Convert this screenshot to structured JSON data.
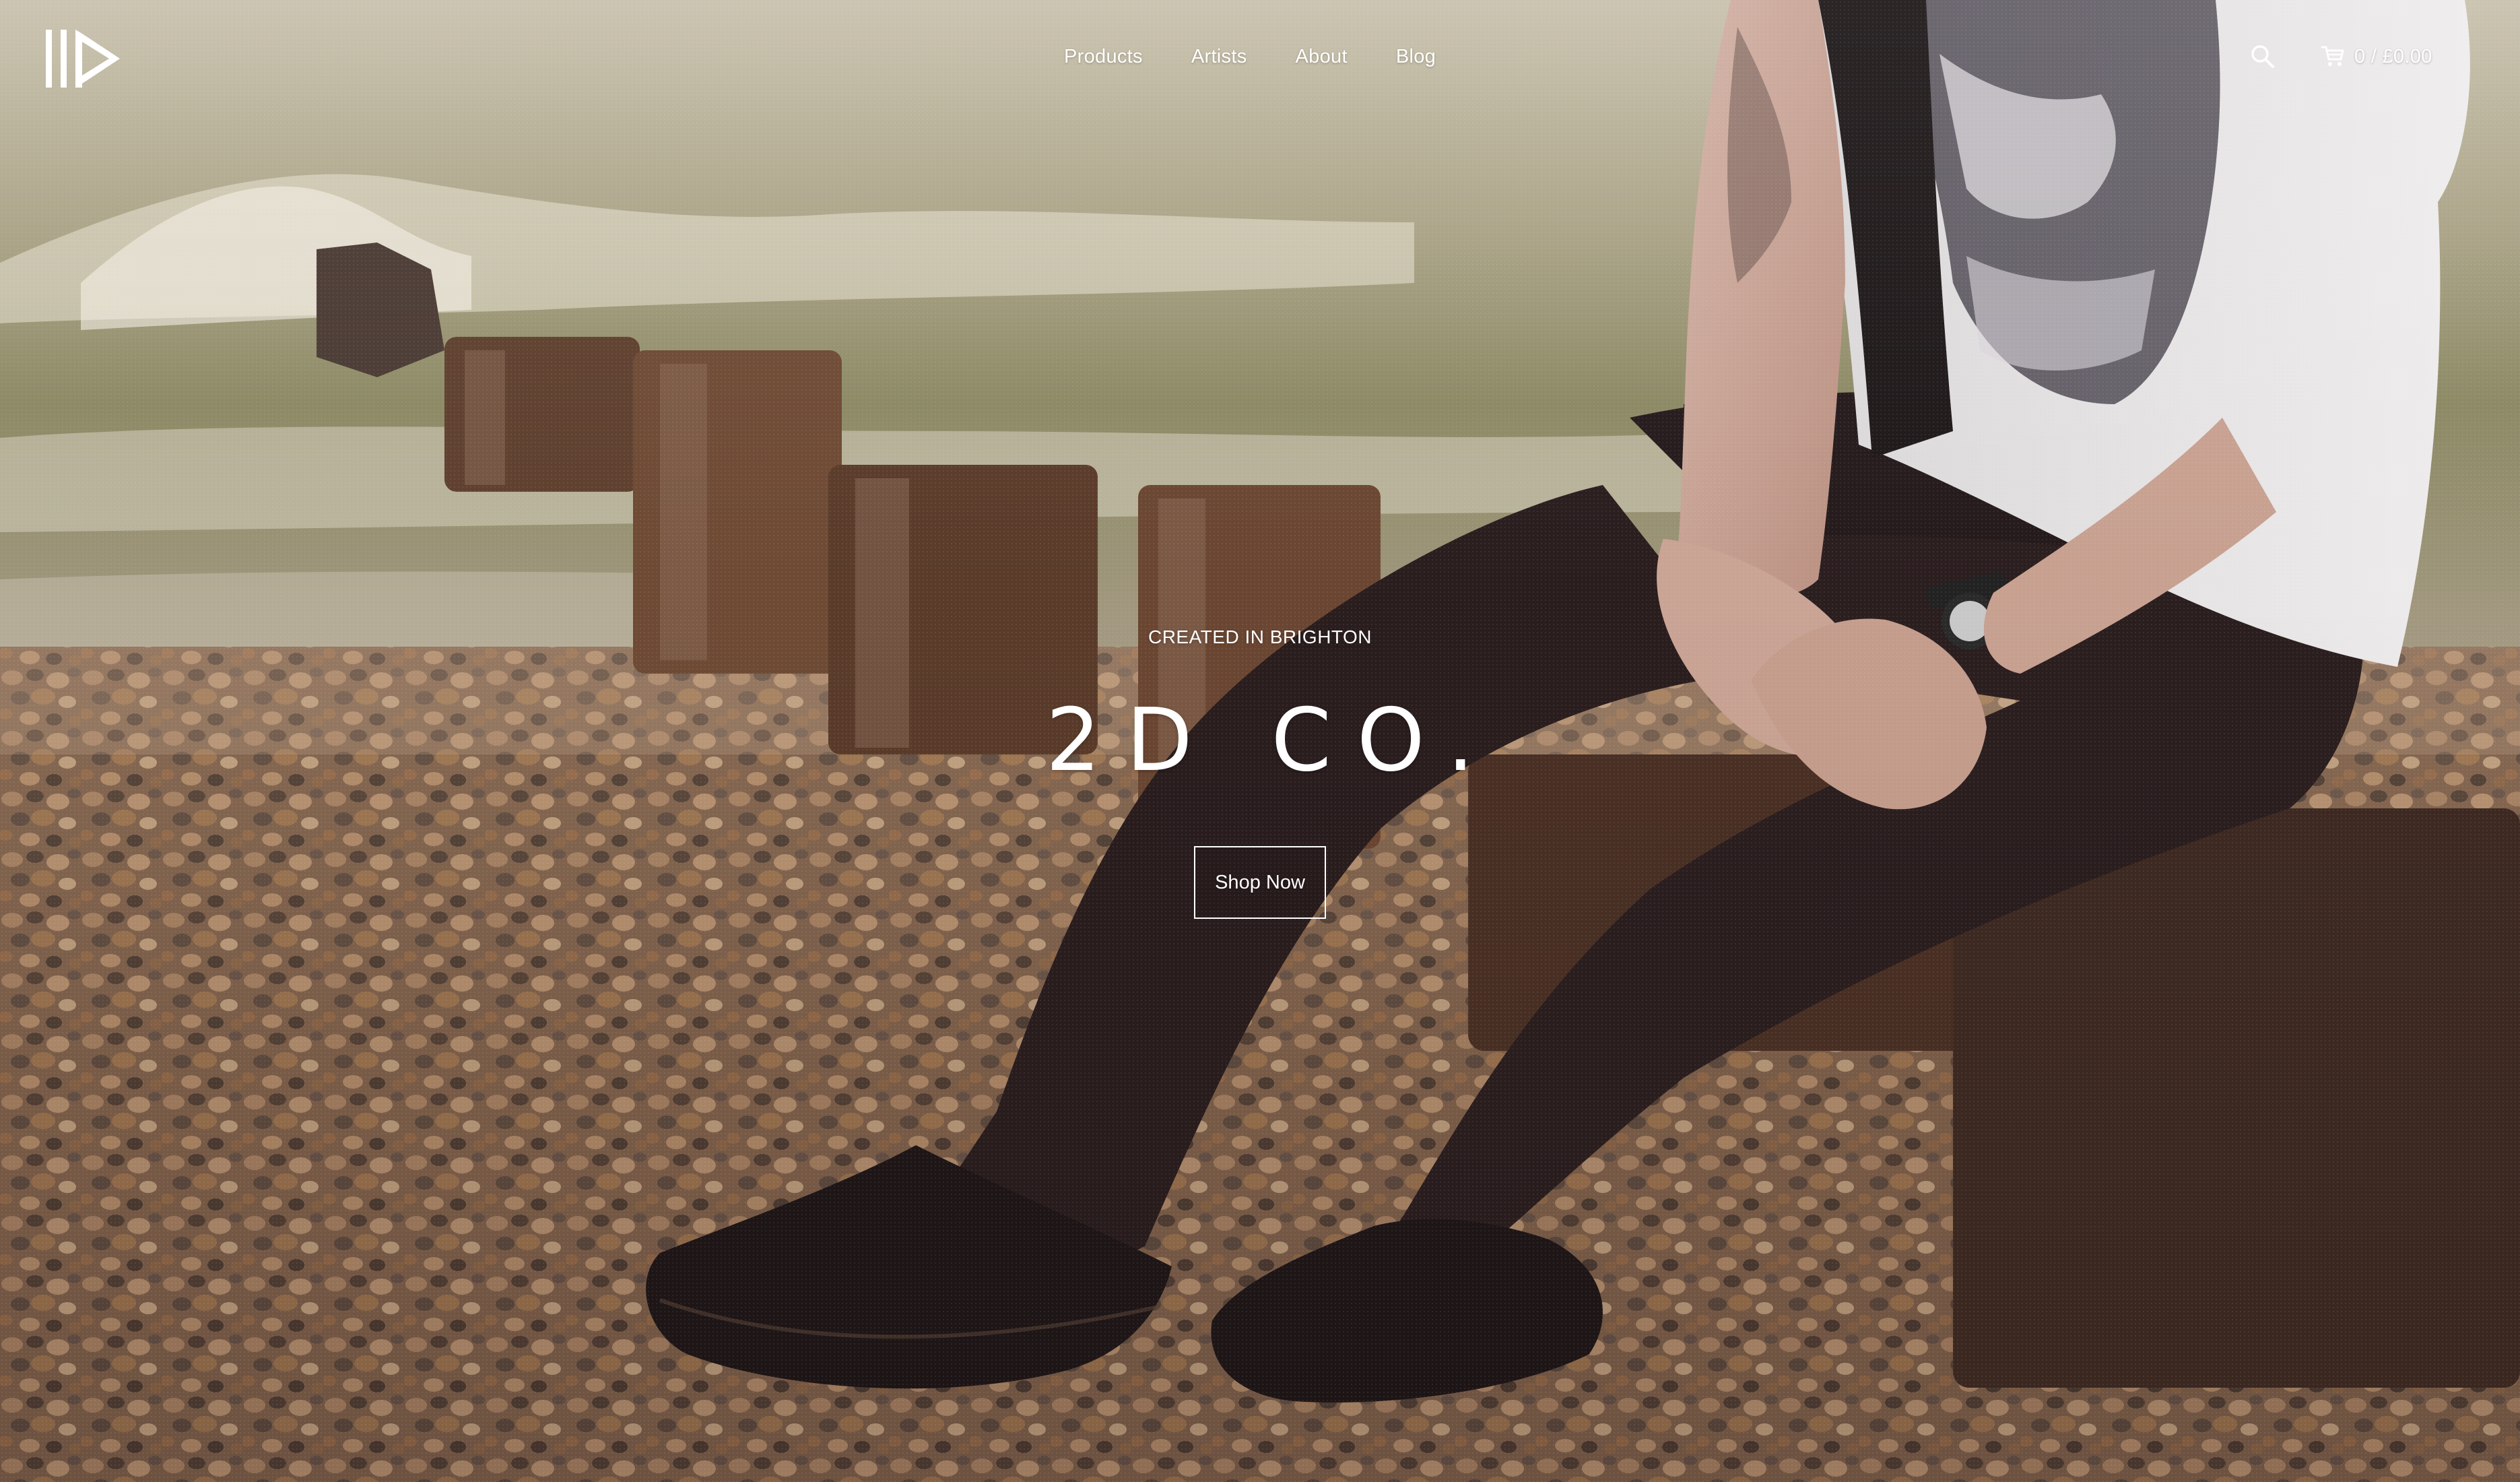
{
  "brand": {
    "logo_icon": "2d-logo-icon"
  },
  "nav": {
    "items": [
      {
        "label": "Products"
      },
      {
        "label": "Artists"
      },
      {
        "label": "About"
      },
      {
        "label": "Blog"
      }
    ]
  },
  "header_actions": {
    "search_icon": "search-icon",
    "cart_icon": "cart-icon",
    "cart_summary": "0 / £0.00"
  },
  "hero": {
    "kicker": "CREATED IN BRIGHTON",
    "title": "2D CO.",
    "cta_label": "Shop Now"
  },
  "colors": {
    "text": "#ffffff",
    "sea": "#8e8a6a",
    "pebbles": "#8a6a4e",
    "shadow": "#2b1f1c"
  }
}
